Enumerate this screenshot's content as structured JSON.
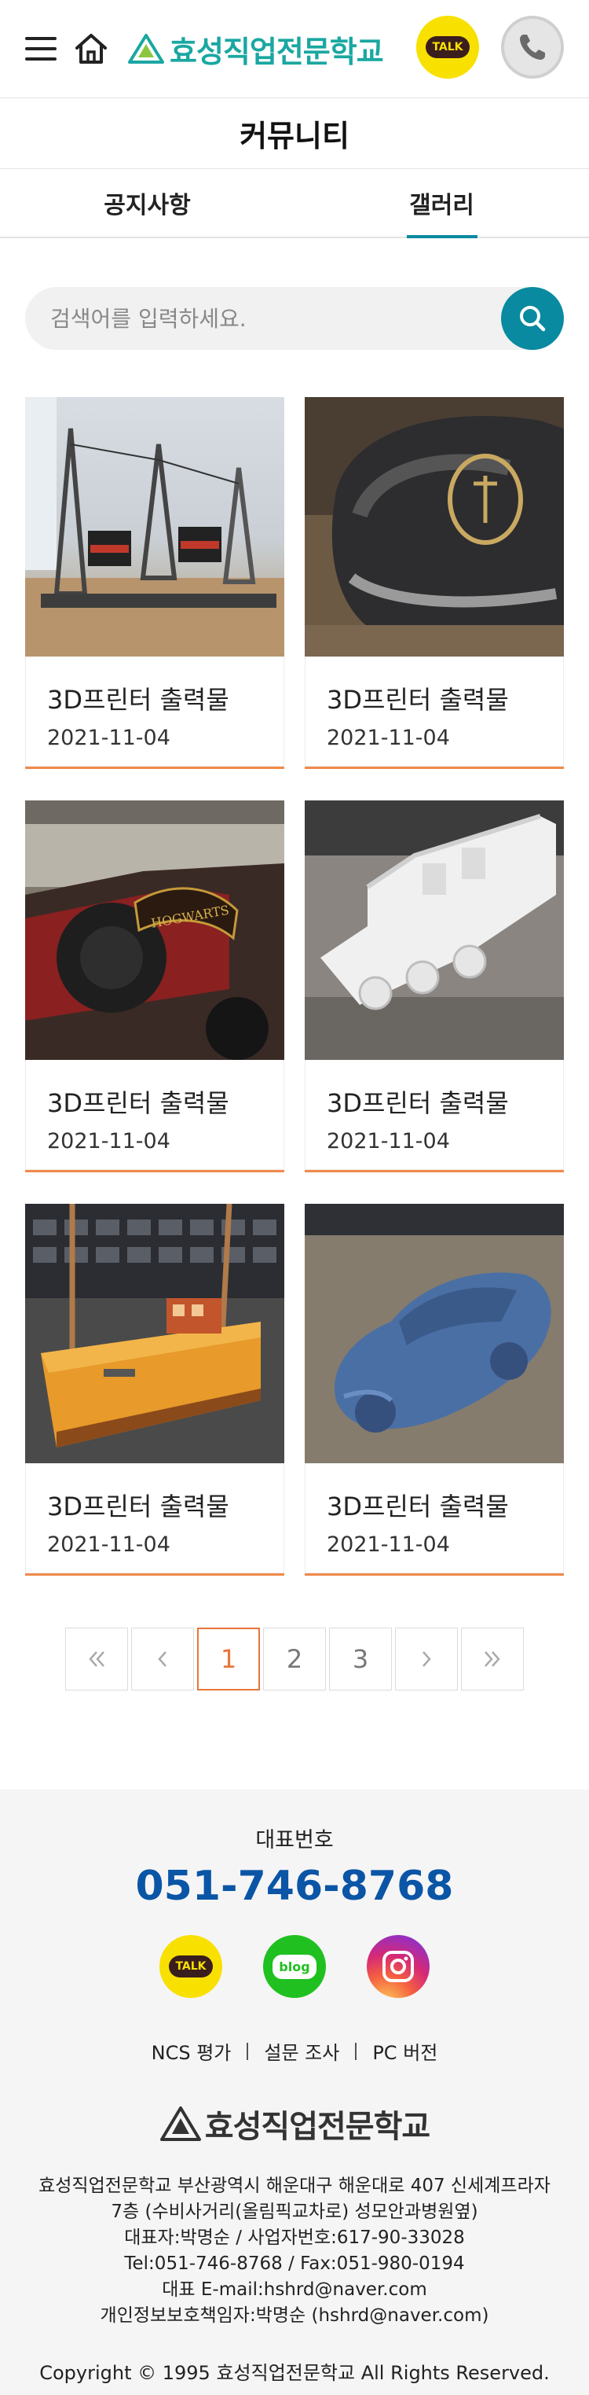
{
  "header": {
    "menu_icon": "hamburger-menu-icon",
    "home_icon": "home-icon",
    "logo_text": "효성직업전문학교",
    "talk_label": "TALK",
    "phone_icon": "phone-icon"
  },
  "page": {
    "title": "커뮤니티"
  },
  "tabs": [
    {
      "label": "공지사항",
      "active": false
    },
    {
      "label": "갤러리",
      "active": true
    }
  ],
  "search": {
    "placeholder": "검색어를 입력하세요.",
    "value": ""
  },
  "gallery": {
    "items": [
      {
        "title": "3D프린터 출력물",
        "date": "2021-11-04"
      },
      {
        "title": "3D프린터 출력물",
        "date": "2021-11-04"
      },
      {
        "title": "3D프린터 출력물",
        "date": "2021-11-04"
      },
      {
        "title": "3D프린터 출력물",
        "date": "2021-11-04"
      },
      {
        "title": "3D프린터 출력물",
        "date": "2021-11-04"
      },
      {
        "title": "3D프린터 출력물",
        "date": "2021-11-04"
      }
    ]
  },
  "pagination": {
    "pages": [
      "1",
      "2",
      "3"
    ],
    "current": "1"
  },
  "footer": {
    "rep_label": "대표번호",
    "rep_phone": "051-746-8768",
    "sns": {
      "talk": "TALK",
      "blog": "blog"
    },
    "links": [
      "NCS 평가",
      "설문 조사",
      "PC 버전"
    ],
    "logo_text": "효성직업전문학교",
    "info": [
      "효성직업전문학교 부산광역시 해운대구 해운대로 407 신세계프라자",
      "7층 (수비사거리(올림픽교차로) 성모안과병원옆)",
      "대표자:박명순 / 사업자번호:617-90-33028",
      "Tel:051-746-8768 / Fax:051-980-0194",
      "대표 E-mail:hshrd@naver.com",
      "개인정보보호책임자:박명순 (hshrd@naver.com)"
    ],
    "copyright": "Copyright © 1995 효성직업전문학교 All Rights Reserved."
  },
  "colors": {
    "brand_teal": "#1aa7a1",
    "accent_blue": "#0a8aa0",
    "phone_blue": "#0a55a6",
    "card_accent": "#f08a4b"
  }
}
